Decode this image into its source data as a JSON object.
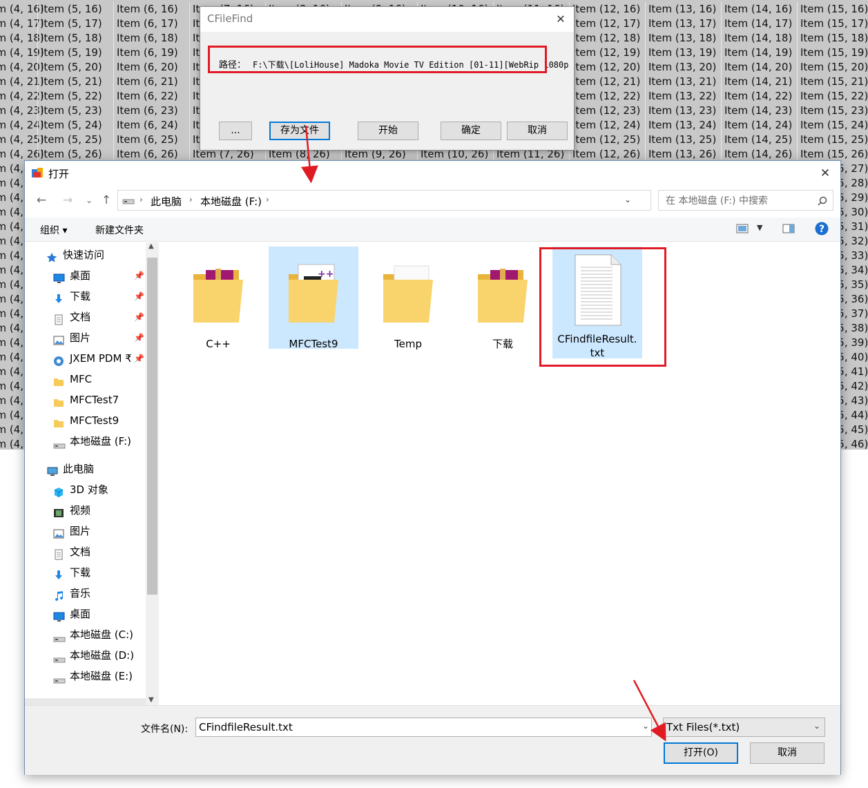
{
  "background_grid": {
    "columns": [
      {
        "label_prefix": "",
        "col": 4,
        "first_row": 16,
        "partial": true
      },
      {
        "col": 5,
        "first_row": 16
      },
      {
        "col": 6,
        "first_row": 16
      },
      {
        "col": 7,
        "first_row": 16
      },
      {
        "col": 8,
        "first_row": 16
      },
      {
        "col": 9,
        "first_row": 16
      },
      {
        "col": 10,
        "first_row": 16
      },
      {
        "col": 11,
        "first_row": 16
      },
      {
        "col": 12,
        "first_row": 16
      },
      {
        "col": 13,
        "first_row": 16
      },
      {
        "col": 14,
        "first_row": 16
      },
      {
        "col": 15,
        "first_row": 16
      }
    ],
    "item_word": "Item",
    "visible_rows_first": 16,
    "visible_rows_last": 46
  },
  "cfilefind": {
    "title": "CFileFind",
    "path_label": "路径：",
    "path_value": "F:\\下载\\[LoliHouse] Madoka Movie TV Edition [01-11][WebRip 1080p",
    "buttons": {
      "browse": "...",
      "save_to_file": "存为文件",
      "start": "开始",
      "ok": "确定",
      "cancel": "取消"
    }
  },
  "open_dialog": {
    "title": "打开",
    "address": {
      "crumbs": [
        "此电脑",
        "本地磁盘 (F:)"
      ]
    },
    "search_placeholder": "在 本地磁盘 (F:) 中搜索",
    "commands": {
      "organize": "组织 ▾",
      "new_folder": "新建文件夹"
    },
    "nav": {
      "quick_access": "快速访问",
      "quick_items": [
        {
          "label": "桌面",
          "icon": "desktop-icon",
          "pinned": true
        },
        {
          "label": "下载",
          "icon": "download-icon",
          "pinned": true
        },
        {
          "label": "文档",
          "icon": "document-icon",
          "pinned": true
        },
        {
          "label": "图片",
          "icon": "pictures-icon",
          "pinned": true
        },
        {
          "label": "JXEM PDM ₹",
          "icon": "pdm-icon",
          "pinned": true
        },
        {
          "label": "MFC",
          "icon": "folder-icon",
          "pinned": false
        },
        {
          "label": "MFCTest7",
          "icon": "folder-icon",
          "pinned": false
        },
        {
          "label": "MFCTest9",
          "icon": "folder-icon",
          "pinned": false
        },
        {
          "label": "本地磁盘 (F:)",
          "icon": "drive-icon",
          "pinned": false
        }
      ],
      "this_pc": "此电脑",
      "pc_items": [
        {
          "label": "3D 对象",
          "icon": "3d-objects-icon"
        },
        {
          "label": "视频",
          "icon": "video-icon"
        },
        {
          "label": "图片",
          "icon": "pictures-icon"
        },
        {
          "label": "文档",
          "icon": "document-icon"
        },
        {
          "label": "下载",
          "icon": "download-icon"
        },
        {
          "label": "音乐",
          "icon": "music-icon"
        },
        {
          "label": "桌面",
          "icon": "desktop-icon"
        },
        {
          "label": "本地磁盘 (C:)",
          "icon": "drive-icon"
        },
        {
          "label": "本地磁盘 (D:)",
          "icon": "drive-icon"
        },
        {
          "label": "本地磁盘 (E:)",
          "icon": "drive-icon"
        }
      ]
    },
    "files": [
      {
        "name": "C++",
        "type": "rar-folder",
        "selected": false
      },
      {
        "name": "MFCTest9",
        "type": "vs-folder",
        "selected": true
      },
      {
        "name": "Temp",
        "type": "folder",
        "selected": false
      },
      {
        "name": "下载",
        "type": "rar-folder",
        "selected": false
      },
      {
        "name_line1": "CFindfileResult.",
        "name_line2": "txt",
        "type": "text-file",
        "selected": true
      }
    ],
    "filename_label": "文件名(N):",
    "filename_value": "CFindfileResult.txt",
    "filter_value": "Txt Files(*.txt)",
    "buttons": {
      "open": "打开(O)",
      "cancel": "取消"
    }
  },
  "colors": {
    "accent": "#0078d7",
    "selection": "#cce8ff",
    "annotation": "#e01b24",
    "folder": "#f6cb5a"
  }
}
